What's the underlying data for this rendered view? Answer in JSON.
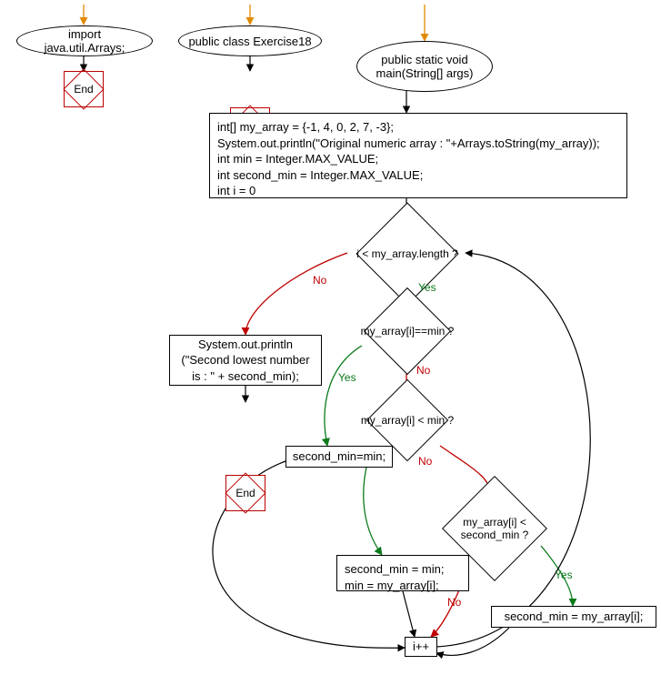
{
  "entry": {
    "import": "import java.util.Arrays;",
    "class": "public class Exercise18",
    "main_line1": "public static void",
    "main_line2": "main(String[] args)"
  },
  "end_label": "End",
  "init": {
    "l1": "int[] my_array = {-1, 4, 0, 2, 7, -3};",
    "l2": "System.out.println(\"Original numeric array : \"+Arrays.toString(my_array));",
    "l3": "int min = Integer.MAX_VALUE;",
    "l4": "int second_min = Integer.MAX_VALUE;",
    "l5": "int i = 0"
  },
  "cond": {
    "loop": "i < my_array.length ?",
    "eq_min": "my_array[i]==min ?",
    "lt_min": "my_array[i] < min ?",
    "lt_second": "my_array[i] <\nsecond_min ?"
  },
  "stmt": {
    "print_l1": "System.out.println",
    "print_l2": "(\"Second lowest number",
    "print_l3": "is : \" + second_min);",
    "sm_eq_min": "second_min=min;",
    "sm_min_swap_l1": "second_min = min;",
    "sm_min_swap_l2": "min = my_array[i];",
    "sm_arr": "second_min = my_array[i];",
    "inc": "i++"
  },
  "branch": {
    "yes": "Yes",
    "no": "No"
  },
  "chart_data": {
    "type": "flowchart",
    "nodes": [
      {
        "id": "n_import",
        "kind": "ellipse",
        "text": "import java.util.Arrays;"
      },
      {
        "id": "end1",
        "kind": "terminator",
        "text": "End"
      },
      {
        "id": "n_class",
        "kind": "ellipse",
        "text": "public class Exercise18"
      },
      {
        "id": "end2",
        "kind": "terminator",
        "text": "End"
      },
      {
        "id": "n_main",
        "kind": "ellipse",
        "text": "public static void main(String[] args)"
      },
      {
        "id": "n_init",
        "kind": "process",
        "text": "int[] my_array = {-1, 4, 0, 2, 7, -3}; System.out.println(\"Original numeric array : \"+Arrays.toString(my_array)); int min = Integer.MAX_VALUE; int second_min = Integer.MAX_VALUE; int i = 0"
      },
      {
        "id": "d_loop",
        "kind": "decision",
        "text": "i < my_array.length ?"
      },
      {
        "id": "n_print",
        "kind": "process",
        "text": "System.out.println(\"Second lowest number is : \" + second_min);"
      },
      {
        "id": "end3",
        "kind": "terminator",
        "text": "End"
      },
      {
        "id": "d_eqmin",
        "kind": "decision",
        "text": "my_array[i]==min ?"
      },
      {
        "id": "n_sm_min",
        "kind": "process",
        "text": "second_min=min;"
      },
      {
        "id": "d_ltmin",
        "kind": "decision",
        "text": "my_array[i] < min ?"
      },
      {
        "id": "n_swap",
        "kind": "process",
        "text": "second_min = min; min = my_array[i];"
      },
      {
        "id": "d_ltsecond",
        "kind": "decision",
        "text": "my_array[i] < second_min ?"
      },
      {
        "id": "n_sm_arr",
        "kind": "process",
        "text": "second_min = my_array[i];"
      },
      {
        "id": "n_inc",
        "kind": "process",
        "text": "i++"
      }
    ],
    "edges": [
      {
        "from": "(external)",
        "to": "n_import"
      },
      {
        "from": "n_import",
        "to": "end1"
      },
      {
        "from": "(external)",
        "to": "n_class"
      },
      {
        "from": "n_class",
        "to": "end2"
      },
      {
        "from": "(external)",
        "to": "n_main"
      },
      {
        "from": "n_main",
        "to": "n_init"
      },
      {
        "from": "n_init",
        "to": "d_loop"
      },
      {
        "from": "d_loop",
        "to": "n_print",
        "label": "No"
      },
      {
        "from": "d_loop",
        "to": "d_eqmin",
        "label": "Yes"
      },
      {
        "from": "n_print",
        "to": "end3"
      },
      {
        "from": "d_eqmin",
        "to": "n_sm_min",
        "label": "Yes"
      },
      {
        "from": "d_eqmin",
        "to": "d_ltmin",
        "label": "No"
      },
      {
        "from": "d_ltmin",
        "to": "n_swap",
        "label": "Yes"
      },
      {
        "from": "d_ltmin",
        "to": "d_ltsecond",
        "label": "No"
      },
      {
        "from": "d_ltsecond",
        "to": "n_sm_arr",
        "label": "Yes"
      },
      {
        "from": "d_ltsecond",
        "to": "n_inc",
        "label": "No"
      },
      {
        "from": "n_sm_min",
        "to": "n_inc"
      },
      {
        "from": "n_swap",
        "to": "n_inc"
      },
      {
        "from": "n_sm_arr",
        "to": "n_inc"
      },
      {
        "from": "n_inc",
        "to": "d_loop"
      }
    ]
  }
}
